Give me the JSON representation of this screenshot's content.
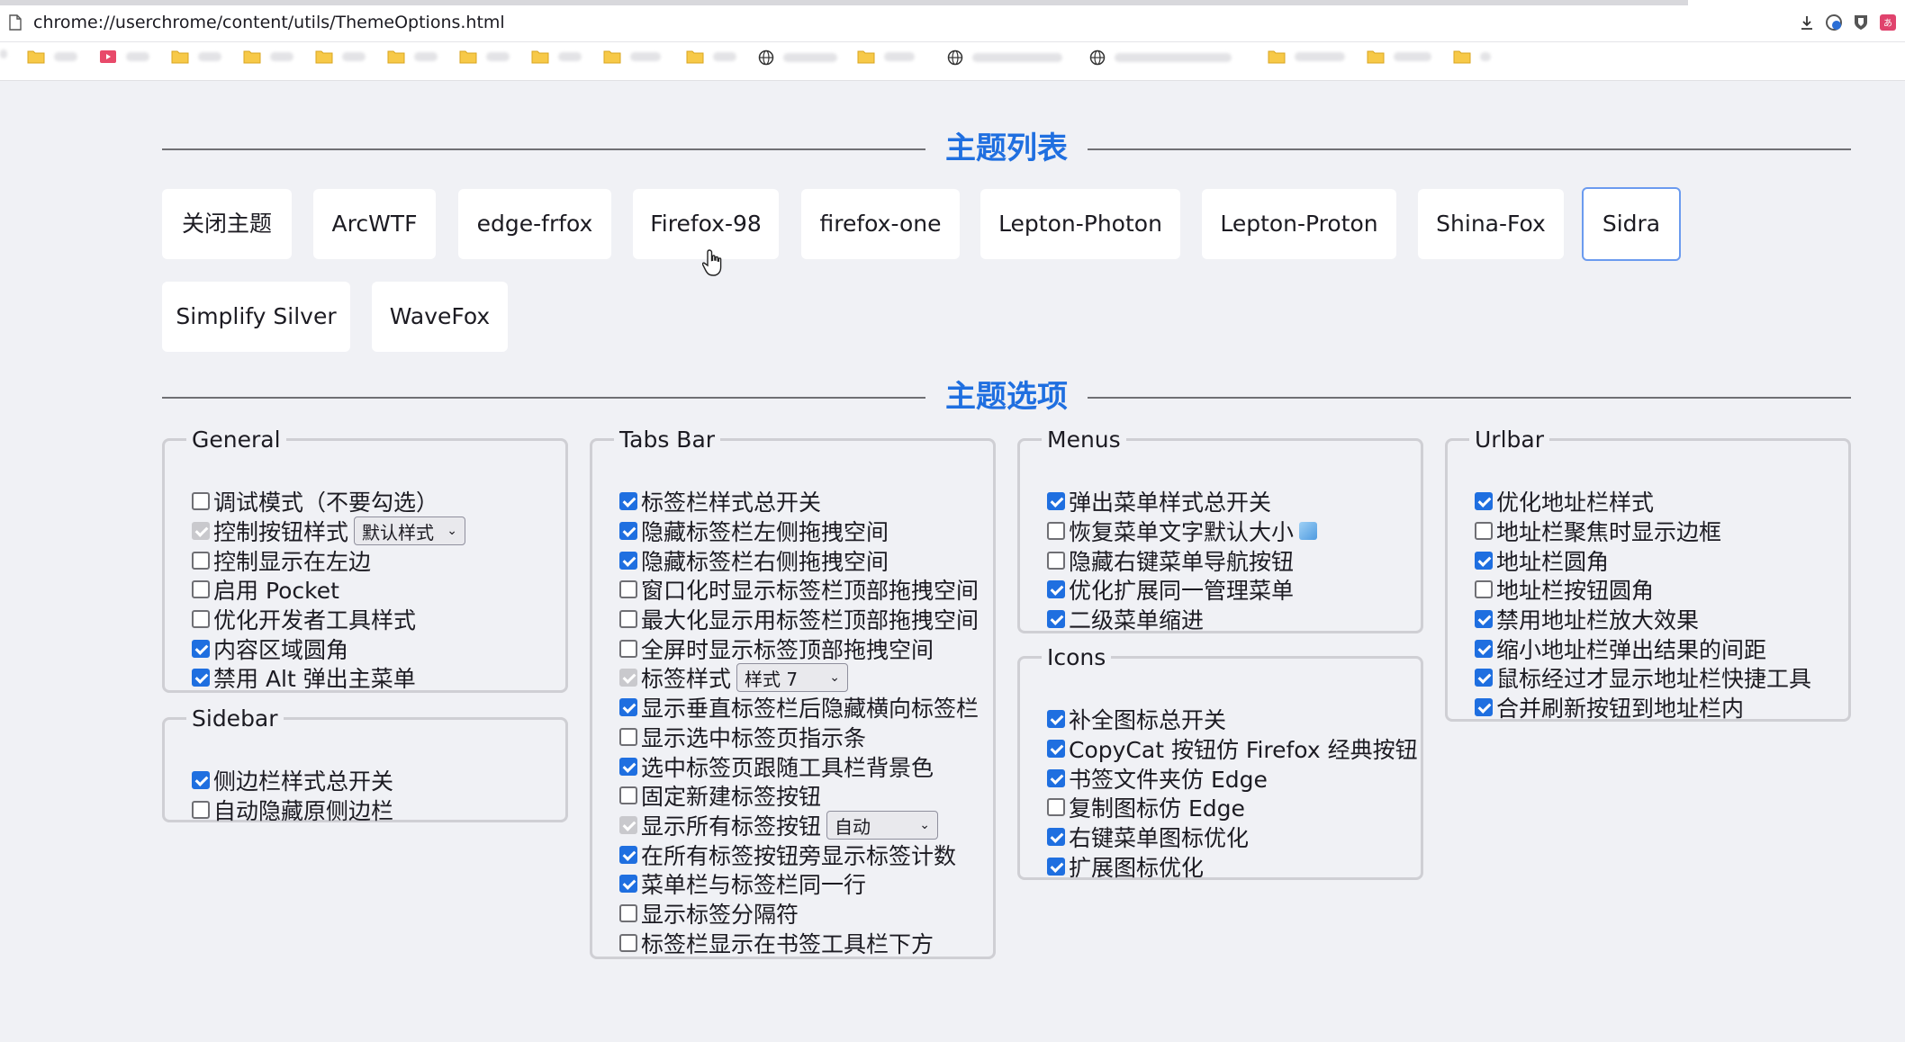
{
  "browser": {
    "url": "chrome://userchrome/content/utils/ThemeOptions.html"
  },
  "sections": {
    "themes_title": "主题列表",
    "options_title": "主题选项"
  },
  "themes": [
    {
      "label": "关闭主题"
    },
    {
      "label": "ArcWTF"
    },
    {
      "label": "edge-frfox"
    },
    {
      "label": "Firefox-98"
    },
    {
      "label": "firefox-one"
    },
    {
      "label": "Lepton-Photon"
    },
    {
      "label": "Lepton-Proton"
    },
    {
      "label": "Shina-Fox"
    },
    {
      "label": "Sidra",
      "selected": true
    },
    {
      "label": "Simplify Silver"
    },
    {
      "label": "WaveFox"
    }
  ],
  "groups": {
    "general": {
      "legend": "General",
      "options": [
        {
          "label": "调试模式（不要勾选）",
          "checked": false
        },
        {
          "label": "控制按钮样式",
          "checked": true,
          "disabled": true,
          "select": "默认样式"
        },
        {
          "label": "控制显示在左边",
          "checked": false
        },
        {
          "label": "启用 Pocket",
          "checked": false
        },
        {
          "label": "优化开发者工具样式",
          "checked": false
        },
        {
          "label": "内容区域圆角",
          "checked": true
        },
        {
          "label": "禁用 Alt 弹出主菜单",
          "checked": true
        }
      ]
    },
    "sidebar": {
      "legend": "Sidebar",
      "options": [
        {
          "label": "侧边栏样式总开关",
          "checked": true
        },
        {
          "label": "自动隐藏原侧边栏",
          "checked": false
        }
      ]
    },
    "tabs": {
      "legend": "Tabs Bar",
      "options": [
        {
          "label": "标签栏样式总开关",
          "checked": true
        },
        {
          "label": "隐藏标签栏左侧拖拽空间",
          "checked": true
        },
        {
          "label": "隐藏标签栏右侧拖拽空间",
          "checked": true
        },
        {
          "label": "窗口化时显示标签栏顶部拖拽空间",
          "checked": false
        },
        {
          "label": "最大化显示用标签栏顶部拖拽空间",
          "checked": false
        },
        {
          "label": "全屏时显示标签顶部拖拽空间",
          "checked": false
        },
        {
          "label": "标签样式",
          "checked": true,
          "disabled": true,
          "select": "样式 7"
        },
        {
          "label": "显示垂直标签栏后隐藏横向标签栏",
          "checked": true
        },
        {
          "label": "显示选中标签页指示条",
          "checked": false
        },
        {
          "label": "选中标签页跟随工具栏背景色",
          "checked": true
        },
        {
          "label": "固定新建标签按钮",
          "checked": false
        },
        {
          "label": "显示所有标签按钮",
          "checked": true,
          "disabled": true,
          "select": "自动"
        },
        {
          "label": "在所有标签按钮旁显示标签计数",
          "checked": true
        },
        {
          "label": "菜单栏与标签栏同一行",
          "checked": true
        },
        {
          "label": "显示标签分隔符",
          "checked": false
        },
        {
          "label": "标签栏显示在书签工具栏下方",
          "checked": false
        }
      ]
    },
    "menus": {
      "legend": "Menus",
      "options": [
        {
          "label": "弹出菜单样式总开关",
          "checked": true
        },
        {
          "label": "恢复菜单文字默认大小",
          "checked": false,
          "icon": true
        },
        {
          "label": "隐藏右键菜单导航按钮",
          "checked": false
        },
        {
          "label": "优化扩展同一管理菜单",
          "checked": true
        },
        {
          "label": "二级菜单缩进",
          "checked": true
        }
      ]
    },
    "icons": {
      "legend": "Icons",
      "options": [
        {
          "label": "补全图标总开关",
          "checked": true
        },
        {
          "label": "CopyCat 按钮仿 Firefox 经典按钮",
          "checked": true
        },
        {
          "label": "书签文件夹仿 Edge",
          "checked": true
        },
        {
          "label": "复制图标仿 Edge",
          "checked": false
        },
        {
          "label": "右键菜单图标优化",
          "checked": true
        },
        {
          "label": "扩展图标优化",
          "checked": true
        }
      ]
    },
    "urlbar": {
      "legend": "Urlbar",
      "options": [
        {
          "label": "优化地址栏样式",
          "checked": true
        },
        {
          "label": "地址栏聚焦时显示边框",
          "checked": false
        },
        {
          "label": "地址栏圆角",
          "checked": true
        },
        {
          "label": "地址栏按钮圆角",
          "checked": false
        },
        {
          "label": "禁用地址栏放大效果",
          "checked": true
        },
        {
          "label": "缩小地址栏弹出结果的间距",
          "checked": true
        },
        {
          "label": "鼠标经过才显示地址栏快捷工具",
          "checked": true
        },
        {
          "label": "合并刷新按钮到地址栏内",
          "checked": true
        }
      ]
    }
  },
  "colors": {
    "accent": "#1f6fe0",
    "background": "#f0f1f5"
  }
}
